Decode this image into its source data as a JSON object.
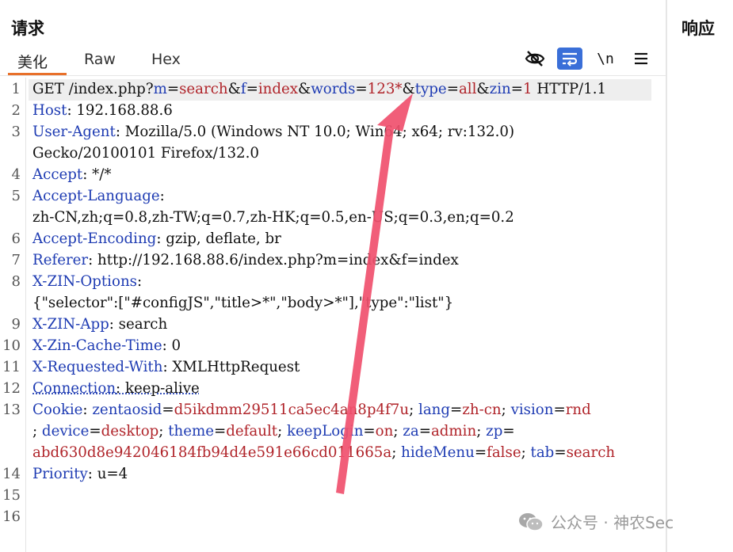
{
  "request_panel": {
    "title": "请求",
    "tabs": [
      {
        "label": "美化",
        "active": true
      },
      {
        "label": "Raw",
        "active": false
      },
      {
        "label": "Hex",
        "active": false
      }
    ],
    "toolbar": {
      "hide_icon": "eye-slash-icon",
      "wrap_icon": "word-wrap-icon",
      "newline_label": "\\n",
      "menu_icon": "hamburger-menu-icon"
    }
  },
  "response_panel": {
    "title": "响应"
  },
  "line_numbers": [
    "1",
    "2",
    "3",
    "4",
    "5",
    "6",
    "7",
    "8",
    "9",
    "10",
    "11",
    "12",
    "13",
    "14",
    "15",
    "16"
  ],
  "request": {
    "l1": {
      "method": "GET ",
      "path": "/index.php?",
      "p1k": "m",
      "p1v": "search",
      "p2k": "f",
      "p2v": "index",
      "p3k": "words",
      "p3v": "123*",
      "p4k": "type",
      "p4v": "all",
      "p5k": "zin",
      "p5v": "1",
      "proto": " HTTP/1.1"
    },
    "host": {
      "k": "Host",
      "v": ": 192.168.88.6"
    },
    "ua": {
      "k": "User-Agent",
      "v": ": Mozilla/5.0 (Windows NT 10.0; Win64; x64; rv:132.0)",
      "v2": "Gecko/20100101 Firefox/132.0"
    },
    "accept": {
      "k": "Accept",
      "v": ": */*"
    },
    "accept_lang": {
      "k": "Accept-Language",
      "v": ":",
      "v2": "zh-CN,zh;q=0.8,zh-TW;q=0.7,zh-HK;q=0.5,en-US;q=0.3,en;q=0.2"
    },
    "accept_enc": {
      "k": "Accept-Encoding",
      "v": ": gzip, deflate, br"
    },
    "referer": {
      "k": "Referer",
      "v": ": http://192.168.88.6/index.php?m=index&f=index"
    },
    "zin_options": {
      "k": "X-ZIN-Options",
      "v": ":",
      "v2": "{\"selector\":[\"#configJS\",\"title>*\",\"body>*\"],\"type\":\"list\"}"
    },
    "zin_app": {
      "k": "X-ZIN-App",
      "v": ": search"
    },
    "zin_cache": {
      "k": "X-Zin-Cache-Time",
      "v": ": 0"
    },
    "requested_with": {
      "k": "X-Requested-With",
      "v": ": XMLHttpRequest"
    },
    "connection": {
      "k": "Connection",
      "v": ": keep-alive"
    },
    "cookie": {
      "k": "Cookie",
      "sep": ": ",
      "c1k": "zentaosid",
      "c1v": "d5ikdmm29511ca5ec4an8p4f7u",
      "c2k": "lang",
      "c2v": "zh-cn",
      "c3k": "vision",
      "c3v": "rnd",
      "c4k": "device",
      "c4v": "desktop",
      "c5k": "theme",
      "c5v": "default",
      "c6k": "keepLogin",
      "c6v": "on",
      "c7k": "za",
      "c7v": "admin",
      "c8k": "zp",
      "c8v": "abd630d8e942046184fb94d4e591e66cd011665a",
      "c9k": "hideMenu",
      "c9v": "false",
      "c10k": "tab",
      "c10v": "search"
    },
    "priority": {
      "k": "Priority",
      "v": ": u=4"
    }
  },
  "watermark": {
    "text": "公众号 · 神农Sec",
    "icon": "wechat-icon"
  },
  "colors": {
    "header_name": "#1f3cb3",
    "param_value": "#b0242a",
    "tab_accent": "#e8702a",
    "toolbar_active": "#3a6fd8",
    "annotation_arrow": "#f0506e"
  }
}
